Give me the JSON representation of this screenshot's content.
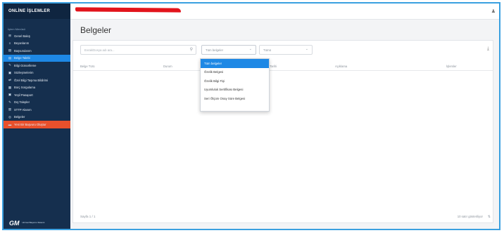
{
  "app": {
    "brand": "ONLİNE İŞLEMLER"
  },
  "sidebar": {
    "section_label": "İşlem Menüsü",
    "items": [
      {
        "label": "Genel Bakış",
        "icon": "⊞"
      },
      {
        "label": "Beyanlarım",
        "icon": "≡"
      },
      {
        "label": "Başvurularım",
        "icon": "▤"
      },
      {
        "label": "Belge Talebi",
        "icon": "▤",
        "active": true
      },
      {
        "label": "Bilgi Güncelleme",
        "icon": "✎"
      },
      {
        "label": "Sözleşmelerim",
        "icon": "▣"
      },
      {
        "label": "Özel Bilgi Taşıma Bildirimi",
        "icon": "⇄"
      },
      {
        "label": "Borç Sorgulama",
        "icon": "▦"
      },
      {
        "label": "Yeşil Pasaport",
        "icon": "▣"
      },
      {
        "label": "Dış Talepler",
        "icon": "✎"
      },
      {
        "label": "STTP Alanım",
        "icon": "▥"
      },
      {
        "label": "Belgeler",
        "icon": "◎"
      },
      {
        "label": "Yeni Bir Başvuru Oluştur",
        "icon": "▬",
        "highlight": true
      }
    ],
    "logo": {
      "text": "GM",
      "subtitle": "Hizmet Başvuru Sistemi"
    }
  },
  "page": {
    "title": "Belgeler"
  },
  "toolbar": {
    "search_placeholder": "Evrak/Dosya adı ara...",
    "type_select_value": "Tüm belgeler",
    "all_select_value": "Tümü"
  },
  "table": {
    "headers": [
      "Belge Türü",
      "Durum",
      "Talep Tarihi",
      "Açıklama",
      "İşlemler"
    ]
  },
  "dropdown": {
    "options": [
      "Tüm belgeler",
      "Özelik Belgesi",
      "Özelik Bilgi Fişi",
      "Uyumluluk Sertifikası Belgesi",
      "Seri Ölçüm Onay Süre Belgesi"
    ],
    "selected_index": 0
  },
  "pagination": {
    "text": "Sayfa 1 / 1"
  },
  "footer": {
    "rows_info": "10 satır gösteriliyor"
  },
  "icons": {
    "user": "user-icon",
    "search": "search-icon",
    "download": "download-icon"
  },
  "colors": {
    "sidebar": "#152f4e",
    "active": "#1e88e5",
    "highlight": "#e8502c",
    "frame": "#3aa0e0",
    "redaction": "#e2141c"
  }
}
